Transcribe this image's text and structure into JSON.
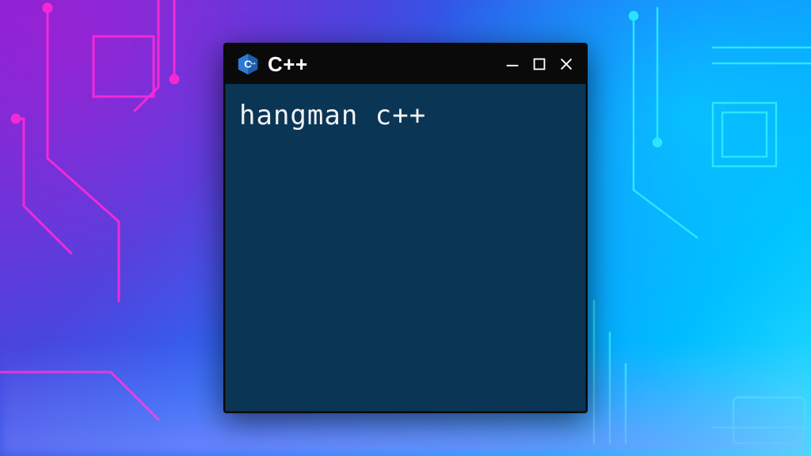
{
  "window": {
    "title": "C++",
    "content_text": "hangman c++"
  },
  "icons": {
    "app": "cpp-logo-icon",
    "minimize": "minimize-icon",
    "maximize": "maximize-icon",
    "close": "close-icon"
  },
  "colors": {
    "titlebar_bg": "#0a0a0a",
    "window_bg": "#0b3555",
    "text": "#f2f2f2",
    "accent_blue": "#2e7bd6",
    "accent_cyan": "#2ee8ff",
    "accent_magenta": "#ff2ad6"
  }
}
